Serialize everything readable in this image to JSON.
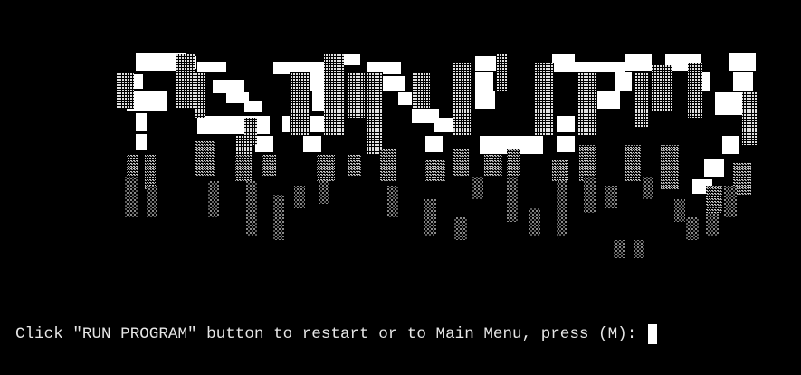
{
  "window": {
    "background": "#000000"
  },
  "banner": {
    "style": "ascii-block-art",
    "colors": {
      "solid": "#ffffff",
      "light": "#d8d8d8",
      "medium": "#a8a8a8",
      "dark": "#6c6c6c"
    }
  },
  "prompt": {
    "text": "Click \"RUN PROGRAM\" button to restart or to Main Menu, press (M): "
  },
  "cursor": {
    "color": "#ffffff"
  }
}
